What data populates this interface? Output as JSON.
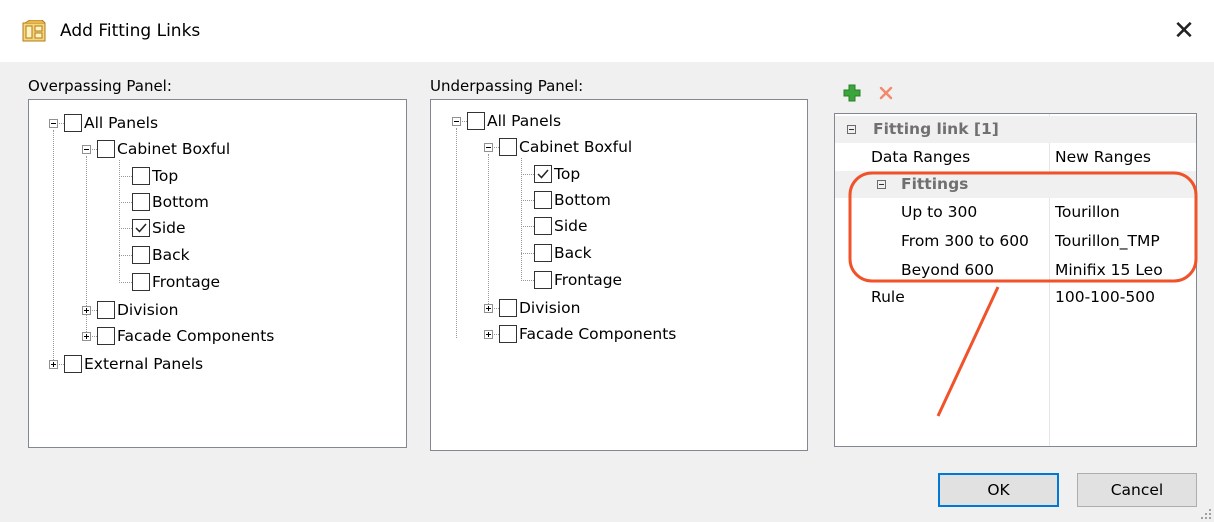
{
  "window": {
    "title": "Add Fitting Links",
    "icon": "fitting-app-icon",
    "close_icon": "close-icon",
    "close_glyph": "✕"
  },
  "overpassing": {
    "label": "Overpassing Panel:",
    "items": [
      {
        "label": "All Panels",
        "checked": false
      },
      {
        "label": "Cabinet Boxful",
        "checked": false
      },
      {
        "label": "Top",
        "checked": false
      },
      {
        "label": "Bottom",
        "checked": false
      },
      {
        "label": "Side",
        "checked": true
      },
      {
        "label": "Back",
        "checked": false
      },
      {
        "label": "Frontage",
        "checked": false
      },
      {
        "label": "Division",
        "checked": false
      },
      {
        "label": "Facade Components",
        "checked": false
      },
      {
        "label": "External Panels",
        "checked": false
      }
    ]
  },
  "underpassing": {
    "label": "Underpassing Panel:",
    "items": [
      {
        "label": "All Panels",
        "checked": false
      },
      {
        "label": "Cabinet Boxful",
        "checked": false
      },
      {
        "label": "Top",
        "checked": true
      },
      {
        "label": "Bottom",
        "checked": false
      },
      {
        "label": "Side",
        "checked": false
      },
      {
        "label": "Back",
        "checked": false
      },
      {
        "label": "Frontage",
        "checked": false
      },
      {
        "label": "Division",
        "checked": false
      },
      {
        "label": "Facade Components",
        "checked": false
      }
    ]
  },
  "toolbar": {
    "add_icon": "add-plus-icon",
    "delete_icon": "delete-x-icon",
    "add_color": "#3aa53a",
    "delete_color": "#f08a6a"
  },
  "properties": {
    "category": "Fitting link [1]",
    "rows": [
      {
        "name": "Data Ranges",
        "value": "New Ranges"
      },
      {
        "name": "Fittings",
        "value": ""
      },
      {
        "name": "Up to 300",
        "value": "Tourillon"
      },
      {
        "name": "From 300 to 600",
        "value": "Tourillon_TMP"
      },
      {
        "name": "Beyond 600",
        "value": "Minifix 15 Leo"
      },
      {
        "name": "Rule",
        "value": "100-100-500"
      }
    ]
  },
  "annotation": {
    "color": "#f0522a",
    "shape": "rounded-rectangle-with-arrow"
  },
  "buttons": {
    "ok": "OK",
    "cancel": "Cancel"
  },
  "colors": {
    "background": "#f0f0f0",
    "default_button_border": "#0078d7"
  }
}
